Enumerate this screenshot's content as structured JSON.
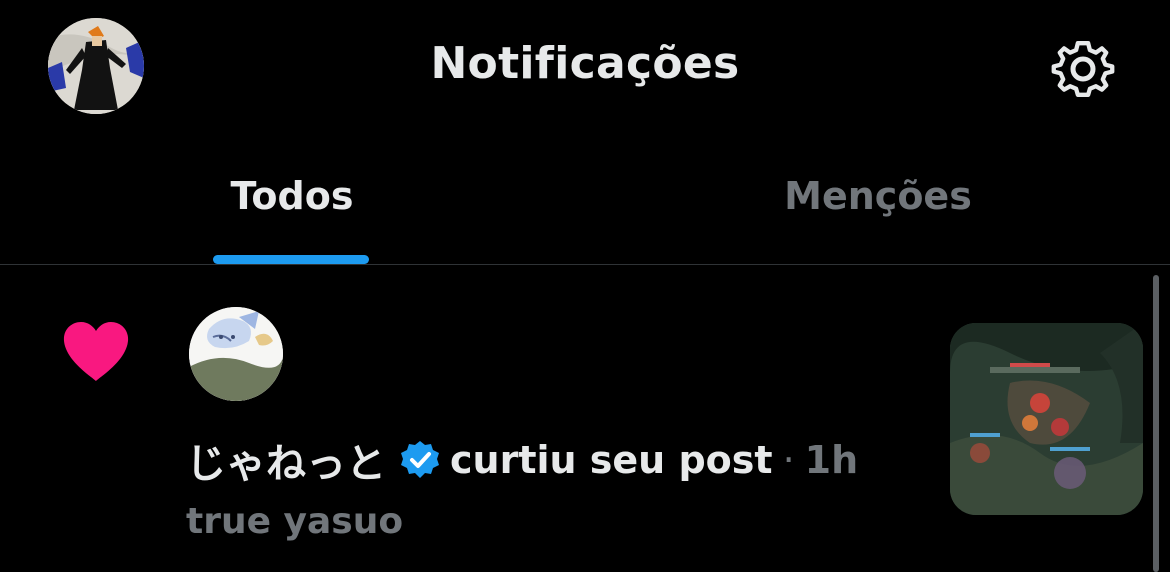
{
  "header": {
    "title": "Notificações",
    "avatar_icon": "profile-avatar",
    "settings_icon": "gear-icon"
  },
  "tabs": [
    {
      "label": "Todos",
      "active": true
    },
    {
      "label": "Menções",
      "active": false
    }
  ],
  "notification": {
    "type_icon": "heart-icon",
    "username": "じゃねっと",
    "verified": true,
    "action": "curtiu seu post",
    "separator": "·",
    "time": "1h",
    "post_text": "true yasuo"
  },
  "colors": {
    "background": "#000000",
    "text_primary": "#e7e9ea",
    "text_secondary": "#71767b",
    "accent": "#1d9bf0",
    "heart": "#f91880",
    "divider": "#2f3336"
  }
}
